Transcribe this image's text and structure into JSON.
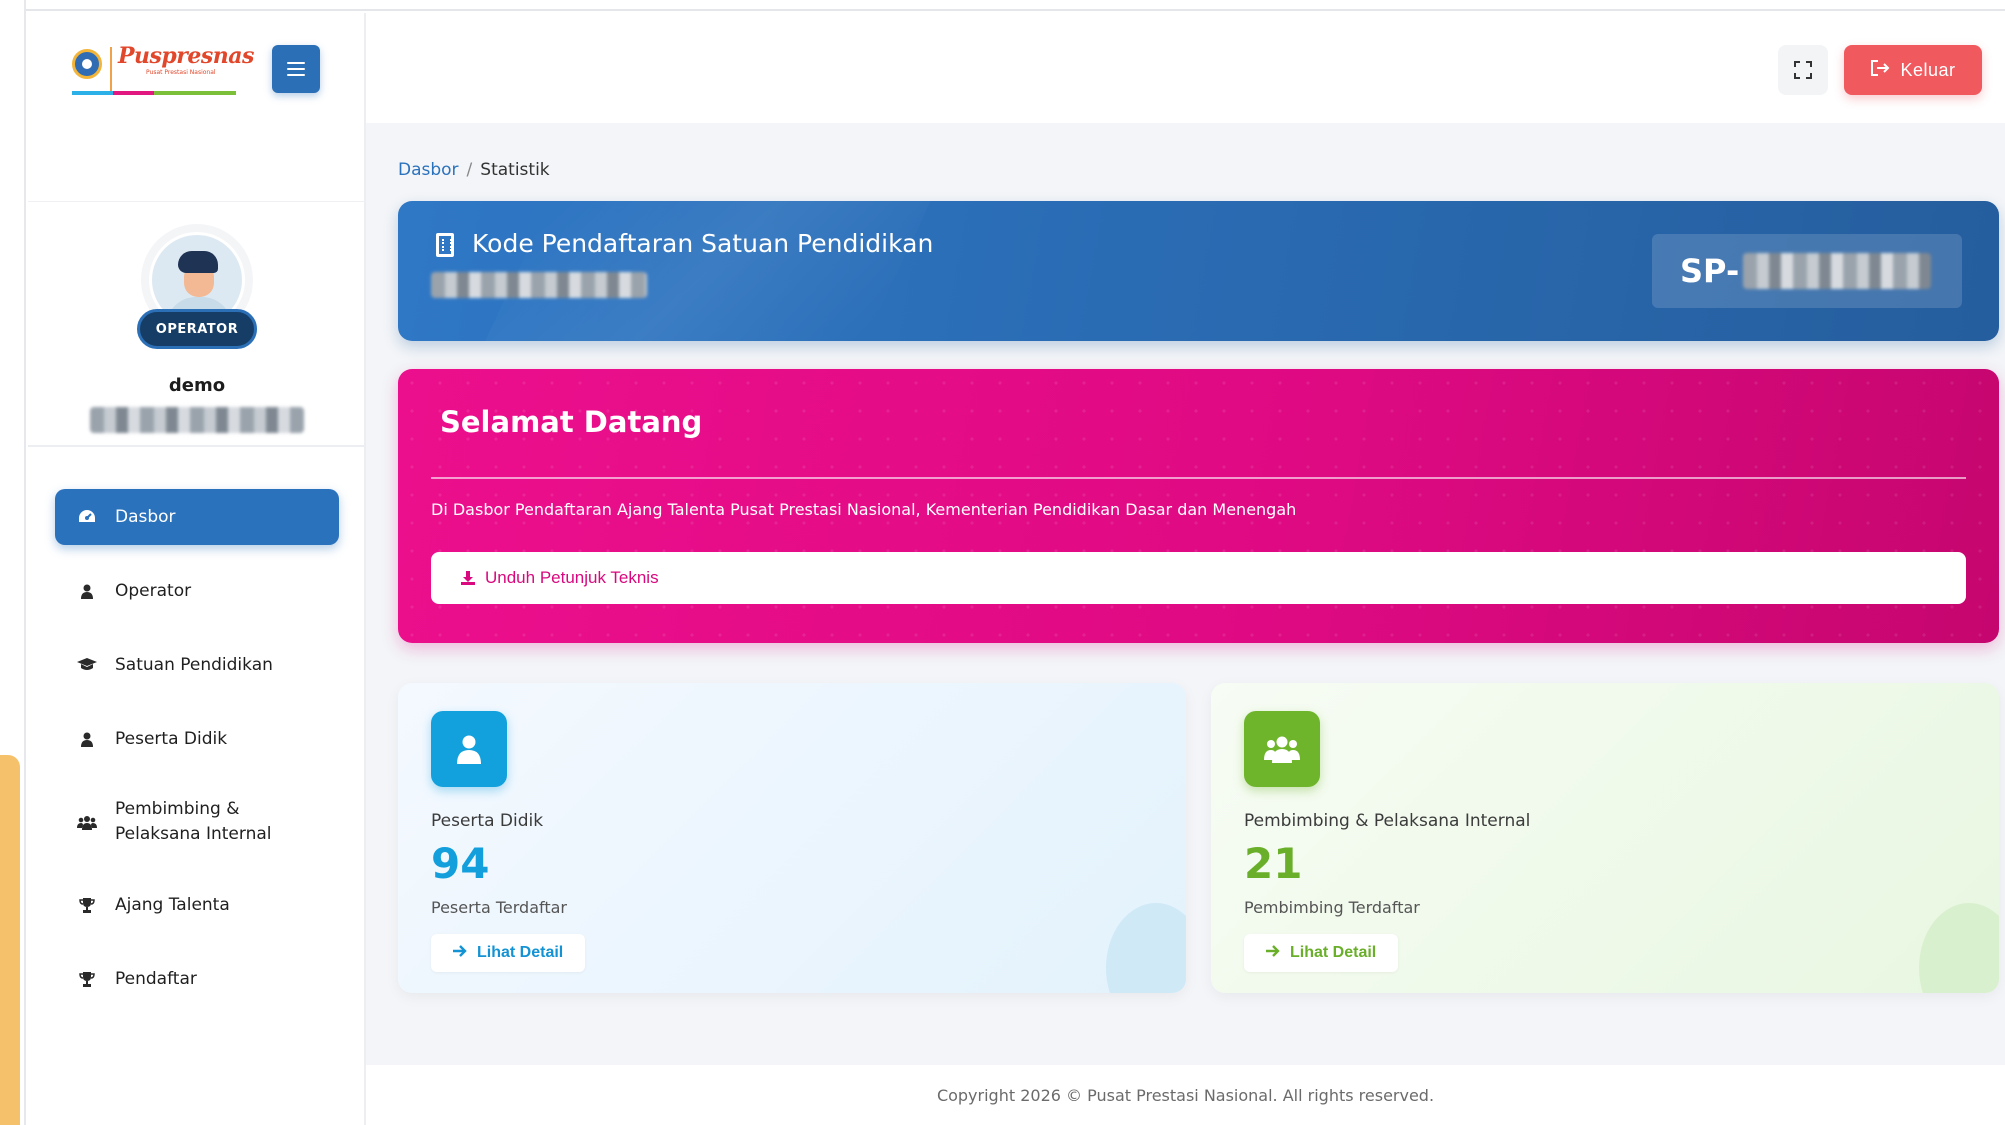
{
  "brand": {
    "logo_text": "Puspresnas",
    "logo_subtext": "Pusat Prestasi Nasional",
    "stripe_colors": [
      "#2bb1e8",
      "#e0187f",
      "#7cc03a",
      "#7cc03a"
    ]
  },
  "profile": {
    "role": "OPERATOR",
    "name": "demo"
  },
  "sidebar": {
    "items": [
      {
        "label": "Dasbor",
        "icon": "dashboard-icon",
        "active": true
      },
      {
        "label": "Operator",
        "icon": "user-icon"
      },
      {
        "label": "Satuan Pendidikan",
        "icon": "graduation-cap-icon"
      },
      {
        "label": "Peserta Didik",
        "icon": "user-icon"
      },
      {
        "label": "Pembimbing & Pelaksana Internal",
        "icon": "users-icon"
      },
      {
        "label": "Ajang Talenta",
        "icon": "trophy-icon"
      },
      {
        "label": "Pendaftar",
        "icon": "trophy-icon"
      }
    ]
  },
  "topbar": {
    "logout_label": "Keluar"
  },
  "breadcrumb": {
    "home": "Dasbor",
    "current": "Statistik"
  },
  "registration": {
    "title": "Kode Pendaftaran Satuan Pendidikan",
    "code_prefix": "SP-"
  },
  "welcome": {
    "title": "Selamat Datang",
    "text": "Di Dasbor Pendaftaran Ajang Talenta Pusat Prestasi Nasional, Kementerian Pendidikan Dasar dan Menengah",
    "download_label": "Unduh Petunjuk Teknis"
  },
  "stats": [
    {
      "label": "Peserta Didik",
      "value": "94",
      "sub": "Peserta Terdaftar",
      "button": "Lihat Detail",
      "color": "#139fdb"
    },
    {
      "label": "Pembimbing & Pelaksana Internal",
      "value": "21",
      "sub": "Pembimbing Terdaftar",
      "button": "Lihat Detail",
      "color": "#6aaf2a"
    }
  ],
  "footer": {
    "text": "Copyright 2026 © Pusat Prestasi Nasional. All rights reserved."
  }
}
